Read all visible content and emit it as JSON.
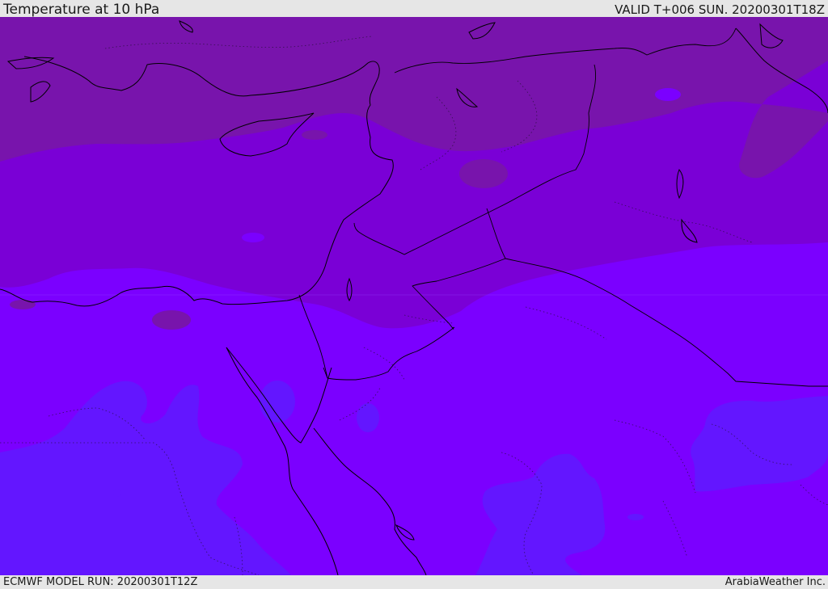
{
  "header": {
    "title": "Temperature at 10 hPa",
    "valid": "VALID T+006 SUN. 20200301T18Z"
  },
  "footer": {
    "model_run": "ECMWF MODEL RUN: 20200301T12Z",
    "brand": "ArabiaWeather Inc."
  },
  "map": {
    "region": "Eastern Mediterranean and Middle East",
    "palette": {
      "coldest_band": "#7814ac",
      "cold_band": "#7a00d6",
      "mid_band": "#7b00ff",
      "warm_band": "#6316ff",
      "coastline": "#000000",
      "border": "#000000"
    }
  }
}
